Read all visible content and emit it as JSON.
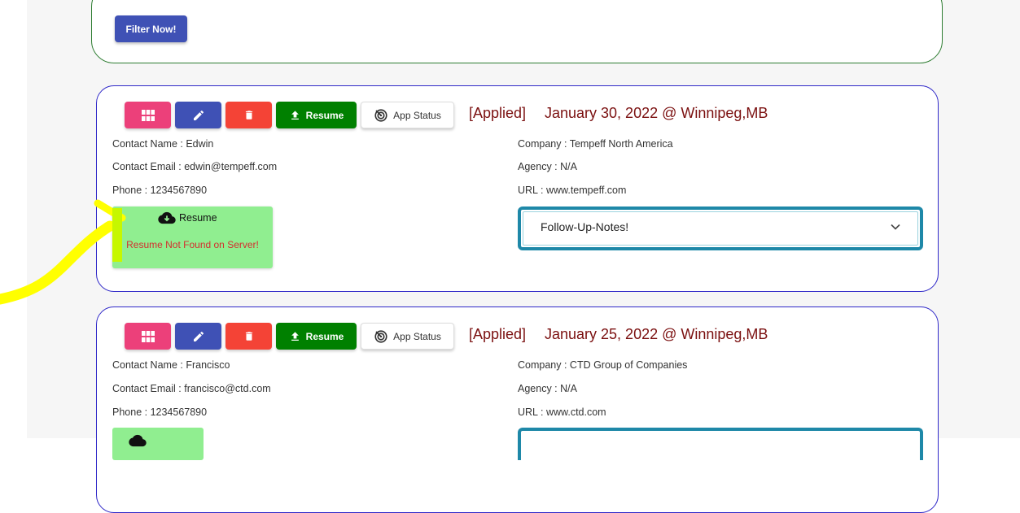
{
  "filter": {
    "button_label": "Filter Now!"
  },
  "colors": {
    "accent_blue": "#3f51b5",
    "pink": "#ec407a",
    "red": "#f44336",
    "green": "#008000",
    "light_green": "#90ee90",
    "maroon_text": "#7b1010",
    "teal_border": "#1e88a8",
    "highlighter": "#ffff00"
  },
  "applications": [
    {
      "toolbar": {
        "grid_icon": "grid-icon",
        "edit_icon": "pencil-icon",
        "delete_icon": "trash-icon",
        "resume_label": "Resume",
        "resume_icon": "upload-icon",
        "status_label": "App Status",
        "status_icon": "radar-icon"
      },
      "status": "[Applied]",
      "date_location": "January 30, 2022 @ Winnipeg,MB",
      "contact_name": "Contact Name : Edwin",
      "contact_email": "Contact Email : edwin@tempeff.com",
      "phone": "Phone : 1234567890",
      "company": "Company : Tempeff North America",
      "agency": "Agency : N/A",
      "url": "URL : www.tempeff.com",
      "resume_download_label": "Resume",
      "resume_download_icon": "cloud-download-icon",
      "resume_error": "Resume Not Found on Server!",
      "notes_label": "Follow-Up-Notes!"
    },
    {
      "toolbar": {
        "grid_icon": "grid-icon",
        "edit_icon": "pencil-icon",
        "delete_icon": "trash-icon",
        "resume_label": "Resume",
        "resume_icon": "upload-icon",
        "status_label": "App Status",
        "status_icon": "radar-icon"
      },
      "status": "[Applied]",
      "date_location": "January 25, 2022 @ Winnipeg,MB",
      "contact_name": "Contact Name : Francisco",
      "contact_email": "Contact Email : francisco@ctd.com",
      "phone": "Phone : 1234567890",
      "company": "Company : CTD Group of Companies",
      "agency": "Agency : N/A",
      "url": "URL : www.ctd.com"
    }
  ]
}
